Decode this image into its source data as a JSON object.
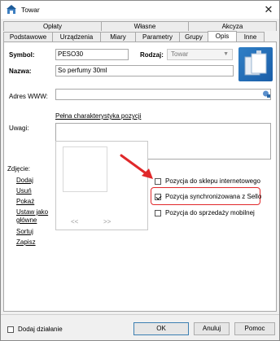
{
  "window": {
    "title": "Towar",
    "close_glyph": "✕"
  },
  "tabs_top": [
    {
      "label": "Opłaty"
    },
    {
      "label": "Własne"
    },
    {
      "label": "Akcyza"
    }
  ],
  "tabs_bottom": [
    {
      "label": "Podstawowe"
    },
    {
      "label": "Urządzenia"
    },
    {
      "label": "Miary"
    },
    {
      "label": "Parametry"
    },
    {
      "label": "Grupy"
    },
    {
      "label": "Opis",
      "active": true
    },
    {
      "label": "Inne"
    }
  ],
  "form": {
    "symbol_label": "Symbol:",
    "symbol_value": "PESO30",
    "rodzaj_label": "Rodzaj:",
    "rodzaj_value": "Towar",
    "nazwa_label": "Nazwa:",
    "nazwa_value": "So perfumy 30ml",
    "www_label": "Adres WWW:",
    "www_value": "",
    "full_spec_link": "Pełna charakterystyka pozycji",
    "uwagi_label": "Uwagi:",
    "uwagi_value": "",
    "zdjecie_label": "Zdjęcie:"
  },
  "photo_actions": {
    "dodaj": "Dodaj",
    "usun": "Usuń",
    "pokaz": "Pokaż",
    "ustaw_jako_glowne_1": "Ustaw jako",
    "ustaw_jako_glowne_2": "główne",
    "sortuj": "Sortuj",
    "zapisz": "Zapisz",
    "prev": "<<",
    "next": ">>"
  },
  "checkboxes": [
    {
      "label": "Pozycja do sklepu internetowego",
      "checked": false
    },
    {
      "label": "Pozycja synchronizowana z Sello",
      "checked": true
    },
    {
      "label": "Pozycja do sprzedaży mobilnej",
      "checked": false
    }
  ],
  "footer": {
    "add_action_label": "Dodaj działanie",
    "add_action_checked": false,
    "ok": "OK",
    "cancel": "Anuluj",
    "help": "Pomoc"
  },
  "colors": {
    "highlight": "#e0282a",
    "arrow": "#e0282a"
  }
}
